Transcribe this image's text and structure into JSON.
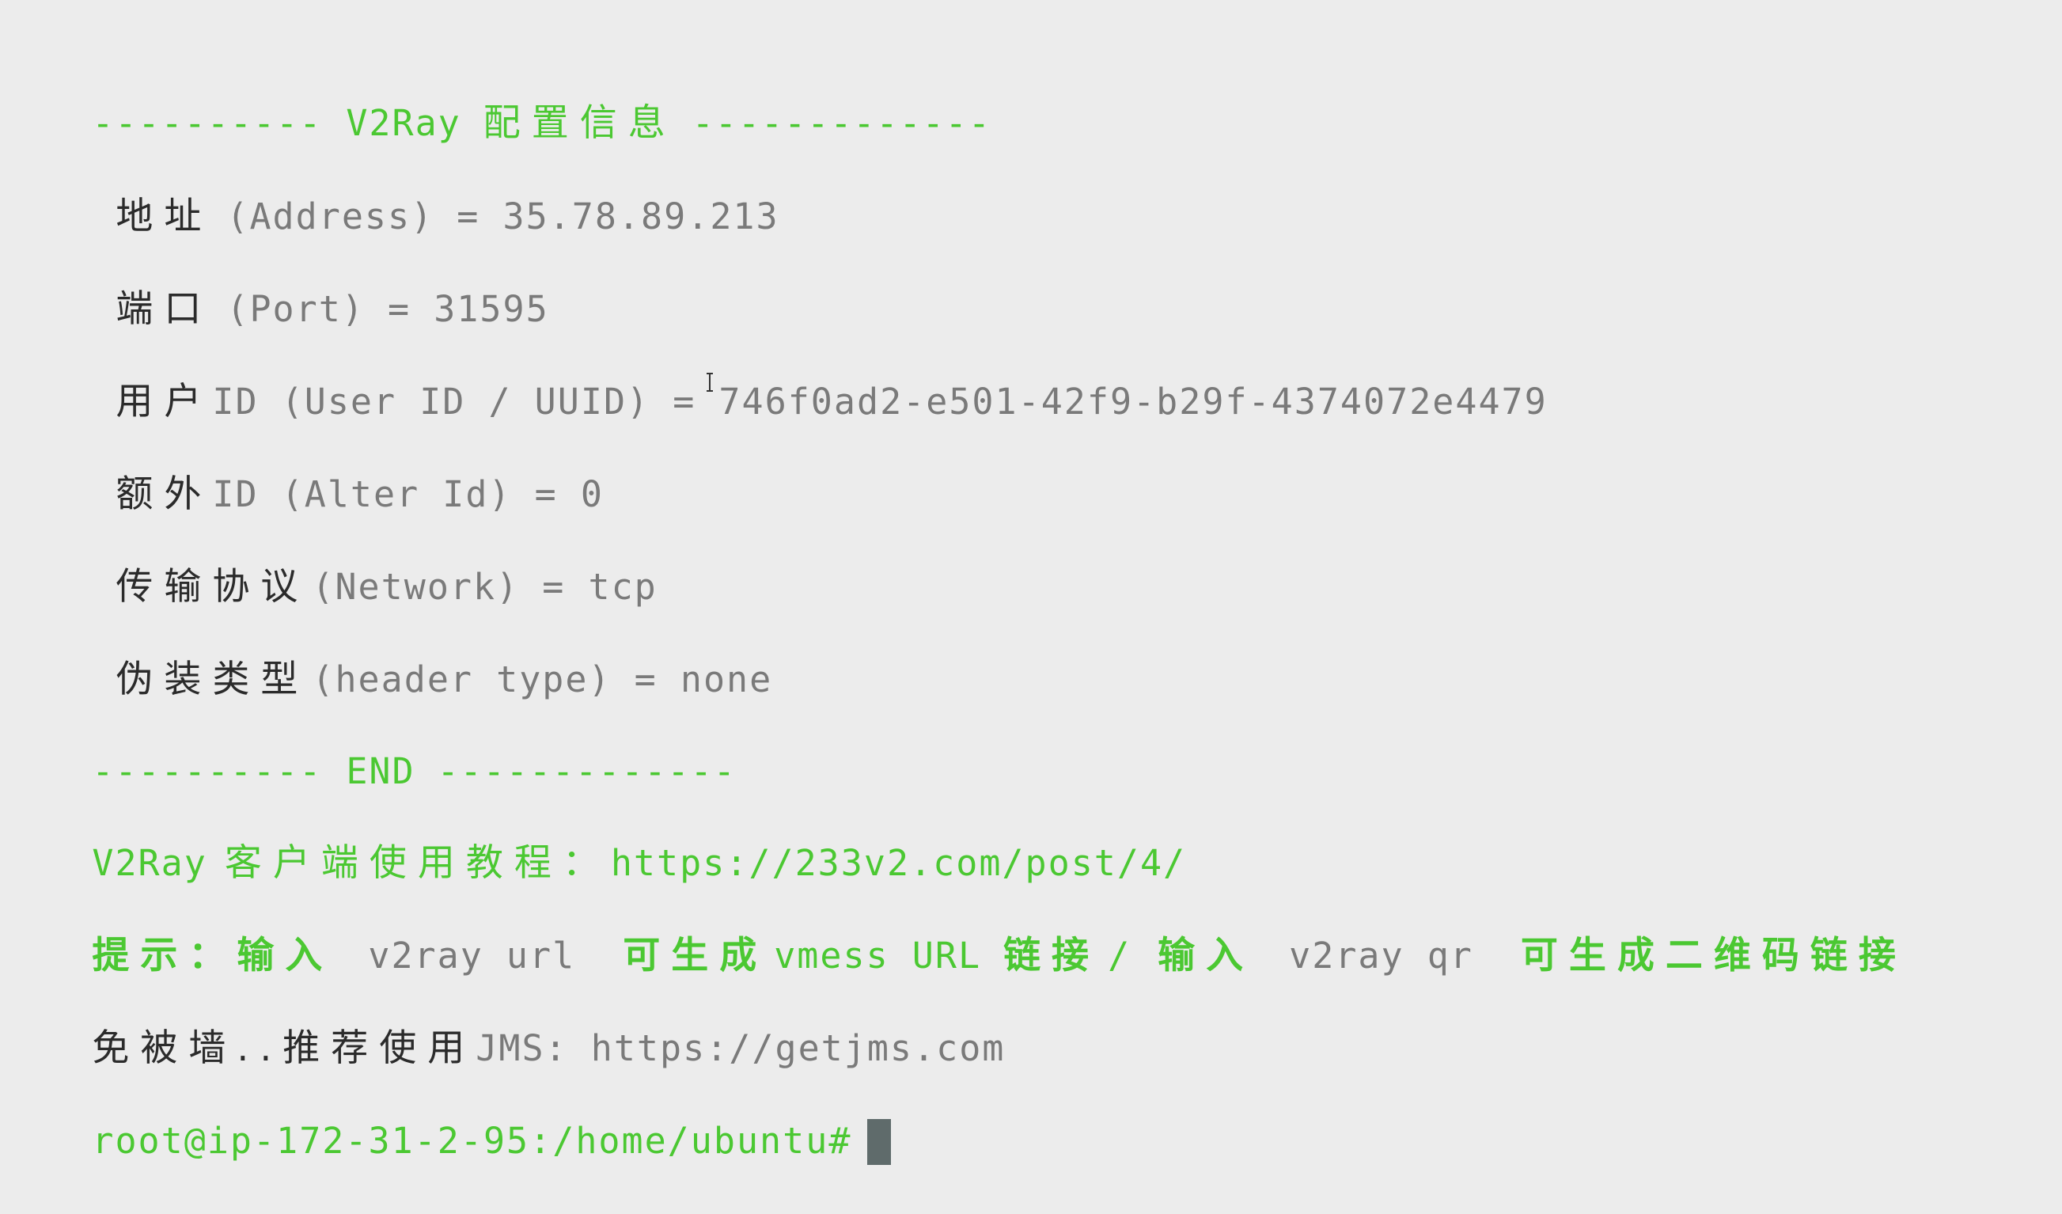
{
  "colors": {
    "background": "#ececec",
    "green": "#4bc832",
    "gray": "#7a7a7a",
    "dark": "#2b2b2b",
    "cursor": "#5f6b6b"
  },
  "header": {
    "left_dashes": "----------",
    "title_en": "V2Ray",
    "title_cn": "配置信息",
    "right_dashes": "-------------"
  },
  "config": {
    "address": {
      "label_cn": "地址",
      "label_en": "(Address) =",
      "value": "35.78.89.213"
    },
    "port": {
      "label_cn": "端口",
      "label_en": "(Port) =",
      "value": "31595"
    },
    "user_id": {
      "label_cn": "用户",
      "label_en": "ID (User ID / UUID) =",
      "value": "746f0ad2-e501-42f9-b29f-4374072e4479"
    },
    "alter_id": {
      "label_cn": "额外",
      "label_en": "ID (Alter Id) =",
      "value": "0"
    },
    "network": {
      "label_cn": "传输协议",
      "label_en": "(Network) =",
      "value": "tcp"
    },
    "header_type": {
      "label_cn": "伪装类型",
      "label_en": "(header type) =",
      "value": "none"
    }
  },
  "end_line": {
    "left_dashes": "----------",
    "label": "END",
    "right_dashes": "-------------"
  },
  "tutorial": {
    "prefix": "V2Ray",
    "label_cn": "客户端使用教程：",
    "url": "https://233v2.com/post/4/"
  },
  "hint": {
    "prefix_cn": "提示：输入",
    "cmd1": "v2ray url",
    "text1_cn": "可生成",
    "text1_en": "vmess URL",
    "text2_cn": "链接",
    "slash": "/",
    "text3_cn": "输入",
    "cmd2": "v2ray qr",
    "text4_cn": "可生成二维码链接"
  },
  "promo": {
    "label_cn": "免被墙..推荐使用",
    "label_en": "JMS:",
    "url": "https://getjms.com"
  },
  "prompt": {
    "text": "root@ip-172-31-2-95:/home/ubuntu#"
  }
}
